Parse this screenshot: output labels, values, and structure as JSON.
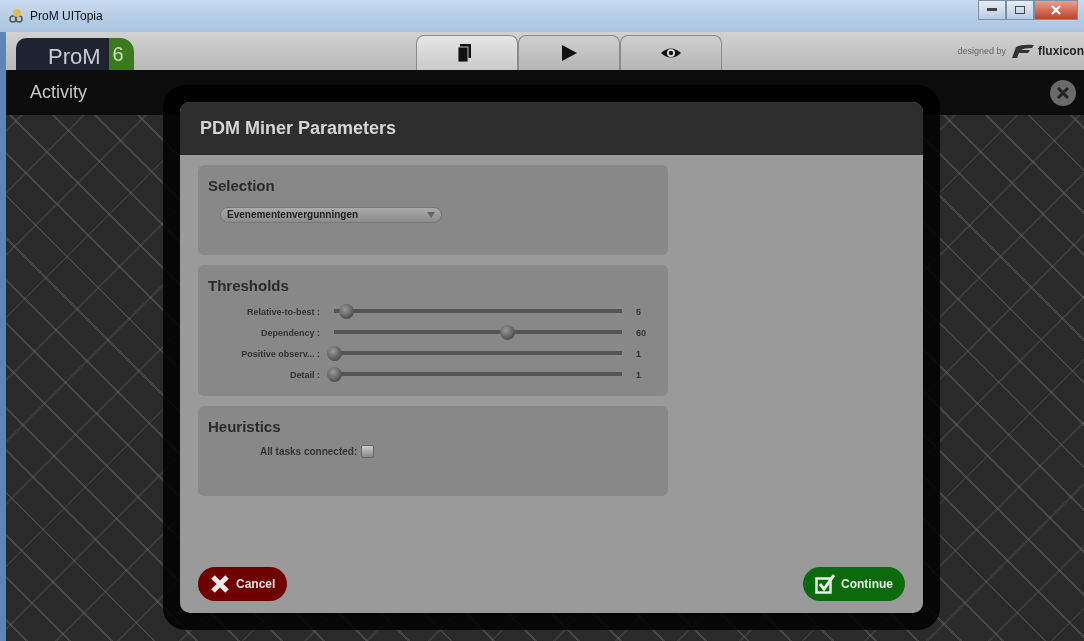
{
  "window": {
    "title": "ProM UITopia"
  },
  "header": {
    "logo_text": "ProM",
    "logo_version": "6",
    "credit": "designed by",
    "credit_brand": "fluxicon"
  },
  "toolbar_tabs": [
    {
      "kind": "documents",
      "selected": true
    },
    {
      "kind": "play",
      "selected": false
    },
    {
      "kind": "view",
      "selected": false
    }
  ],
  "activity_bar": {
    "title": "Activity"
  },
  "dialog": {
    "title": "PDM Miner Parameters",
    "selection": {
      "heading": "Selection",
      "dropdown_value": "Evenementenvergunningen"
    },
    "thresholds": {
      "heading": "Thresholds",
      "sliders": [
        {
          "label": "Relative-to-best :",
          "level": 0.04,
          "reading": "5"
        },
        {
          "label": "Dependency :",
          "level": 0.6,
          "reading": "60"
        },
        {
          "label": "Positive observ... :",
          "level": 0,
          "reading": "1"
        },
        {
          "label": "Detail :",
          "level": 0,
          "reading": "1"
        }
      ]
    },
    "heuristics": {
      "heading": "Heuristics",
      "options": [
        {
          "label": "All tasks connected:",
          "checked": false
        }
      ]
    },
    "buttons": [
      {
        "kind": "cancel",
        "label": "Cancel"
      },
      {
        "kind": "continue",
        "label": "Continue"
      }
    ]
  }
}
